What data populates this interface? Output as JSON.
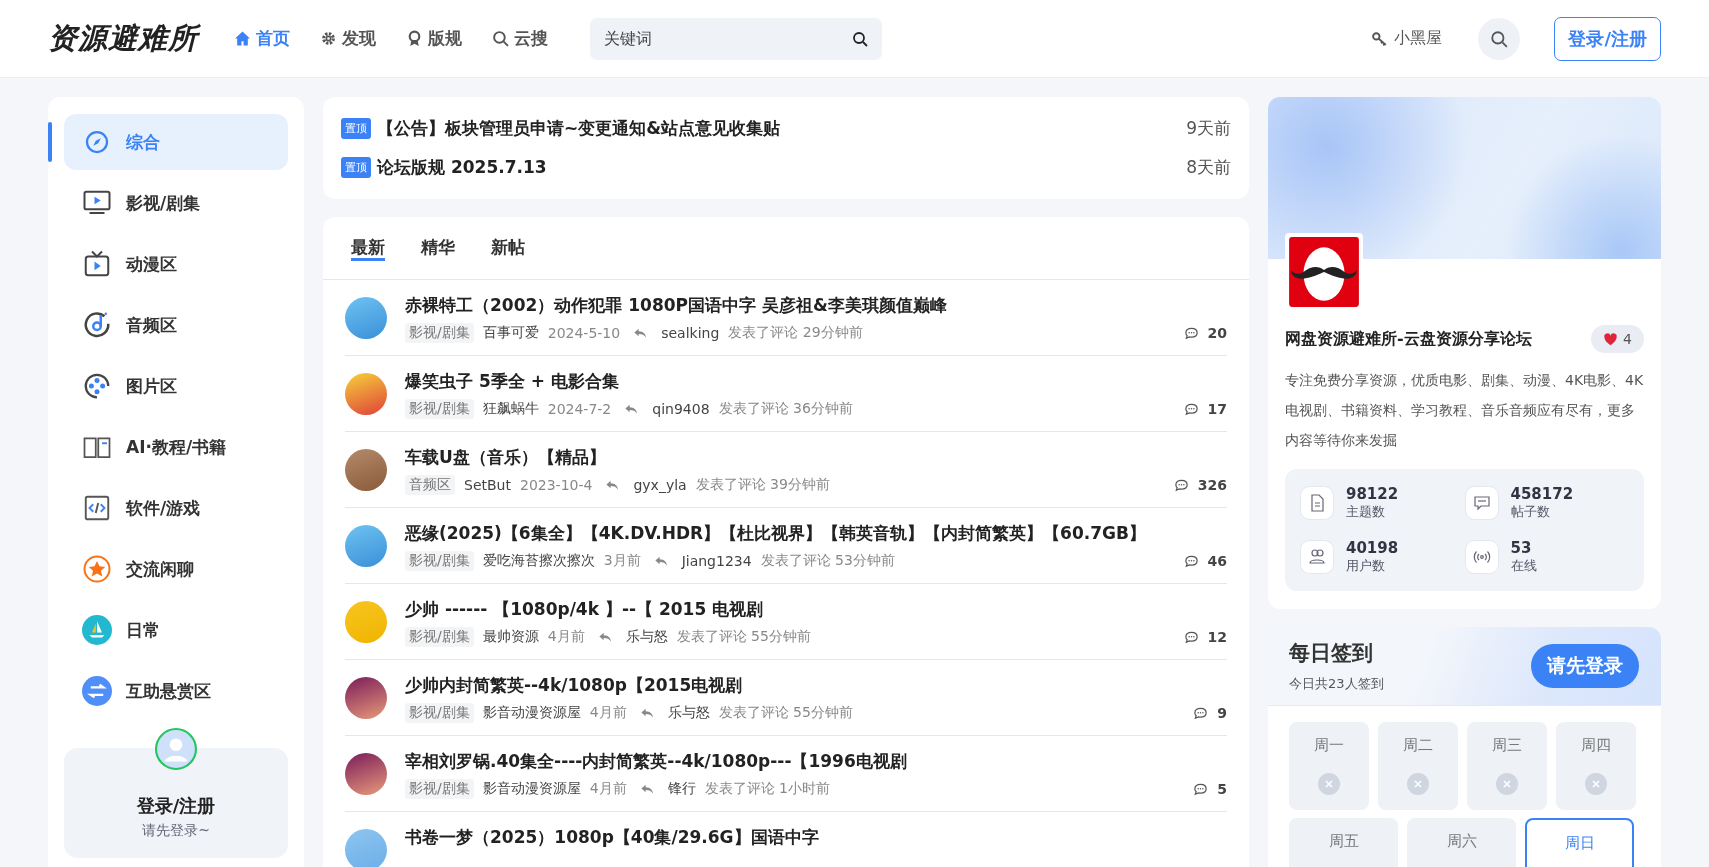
{
  "header": {
    "logo": "资源避难所",
    "nav": [
      {
        "label": "首页",
        "selected": true
      },
      {
        "label": "发现",
        "selected": false
      },
      {
        "label": "版规",
        "selected": false
      },
      {
        "label": "云搜",
        "selected": false
      }
    ],
    "search": {
      "placeholder": "关键词"
    },
    "room_link": "小黑屋",
    "login_button": "登录/注册"
  },
  "sidebar": {
    "items": [
      {
        "label": "综合",
        "selected": true
      },
      {
        "label": "影视/剧集",
        "selected": false
      },
      {
        "label": "动漫区",
        "selected": false
      },
      {
        "label": "音频区",
        "selected": false
      },
      {
        "label": "图片区",
        "selected": false
      },
      {
        "label": "AI·教程/书籍",
        "selected": false
      },
      {
        "label": "软件/游戏",
        "selected": false
      },
      {
        "label": "交流闲聊",
        "selected": false
      },
      {
        "label": "日常",
        "selected": false
      },
      {
        "label": "互助悬赏区",
        "selected": false
      }
    ],
    "user": {
      "title": "登录/注册",
      "subtitle": "请先登录~"
    }
  },
  "pinned": [
    {
      "badge": "置顶",
      "title": "【公告】板块管理员申请~变更通知&站点意见收集贴",
      "time": "9天前"
    },
    {
      "badge": "置顶",
      "title": "论坛版规 2025.7.13",
      "time": "8天前"
    }
  ],
  "tabs": [
    {
      "label": "最新",
      "selected": true
    },
    {
      "label": "精华",
      "selected": false
    },
    {
      "label": "新帖",
      "selected": false
    }
  ],
  "posts": [
    {
      "title": "赤裸特工（2002）动作犯罪 1080P国语中字 吴彦祖&李美琪颜值巅峰",
      "category": "影视/剧集",
      "author": "百事可爱",
      "date": "2024-5-10",
      "replier": "sealking",
      "action": "发表了评论",
      "ago": "29分钟前",
      "comments": "20"
    },
    {
      "title": "爆笑虫子 5季全 + 电影合集",
      "category": "影视/剧集",
      "author": "狂飙蜗牛",
      "date": "2024-7-2",
      "replier": "qin9408",
      "action": "发表了评论",
      "ago": "36分钟前",
      "comments": "17"
    },
    {
      "title": "车载U盘（音乐）【精品】",
      "category": "音频区",
      "author": "SetBut",
      "date": "2023-10-4",
      "replier": "gyx_yla",
      "action": "发表了评论",
      "ago": "39分钟前",
      "comments": "326"
    },
    {
      "title": "恶缘(2025)【6集全】【4K.DV.HDR】【杜比视界】【韩英音轨】【内封简繁英】【60.7GB】",
      "category": "影视/剧集",
      "author": "爱吃海苔擦次擦次",
      "date": "3月前",
      "replier": "Jiang1234",
      "action": "发表了评论",
      "ago": "53分钟前",
      "comments": "46"
    },
    {
      "title": "少帅 ------ 【1080p/4k 】--【 2015 电视剧",
      "category": "影视/剧集",
      "author": "最帅资源",
      "date": "4月前",
      "replier": "乐与怒",
      "action": "发表了评论",
      "ago": "55分钟前",
      "comments": "12"
    },
    {
      "title": "少帅内封简繁英--4k/1080p【2015电视剧",
      "category": "影视/剧集",
      "author": "影音动漫资源屋",
      "date": "4月前",
      "replier": "乐与怒",
      "action": "发表了评论",
      "ago": "55分钟前",
      "comments": "9"
    },
    {
      "title": "宰相刘罗锅.40集全----内封简繁英--4k/1080p---【1996电视剧",
      "category": "影视/剧集",
      "author": "影音动漫资源屋",
      "date": "4月前",
      "replier": "锋行",
      "action": "发表了评论",
      "ago": "1小时前",
      "comments": "5"
    },
    {
      "title": "书卷一梦（2025）1080p【40集/29.6G】国语中字"
    }
  ],
  "site": {
    "name": "网盘资源避难所-云盘资源分享论坛",
    "likes": "4",
    "description": "专注免费分享资源，优质电影、剧集、动漫、4K电影、4K电视剧、书籍资料、学习教程、音乐音频应有尽有，更多内容等待你来发掘",
    "stats": [
      {
        "value": "98122",
        "label": "主题数"
      },
      {
        "value": "458172",
        "label": "帖子数"
      },
      {
        "value": "40198",
        "label": "用户数"
      },
      {
        "value": "53",
        "label": "在线"
      }
    ]
  },
  "checkin": {
    "title": "每日签到",
    "subtitle": "今日共23人签到",
    "button": "请先登录",
    "days": [
      {
        "label": "周一",
        "selected": false,
        "checked": false
      },
      {
        "label": "周二",
        "selected": false,
        "checked": false
      },
      {
        "label": "周三",
        "selected": false,
        "checked": false
      },
      {
        "label": "周四",
        "selected": false,
        "checked": false
      },
      {
        "label": "周五",
        "selected": false
      },
      {
        "label": "周六",
        "selected": false
      },
      {
        "label": "周日",
        "selected": true
      }
    ]
  }
}
